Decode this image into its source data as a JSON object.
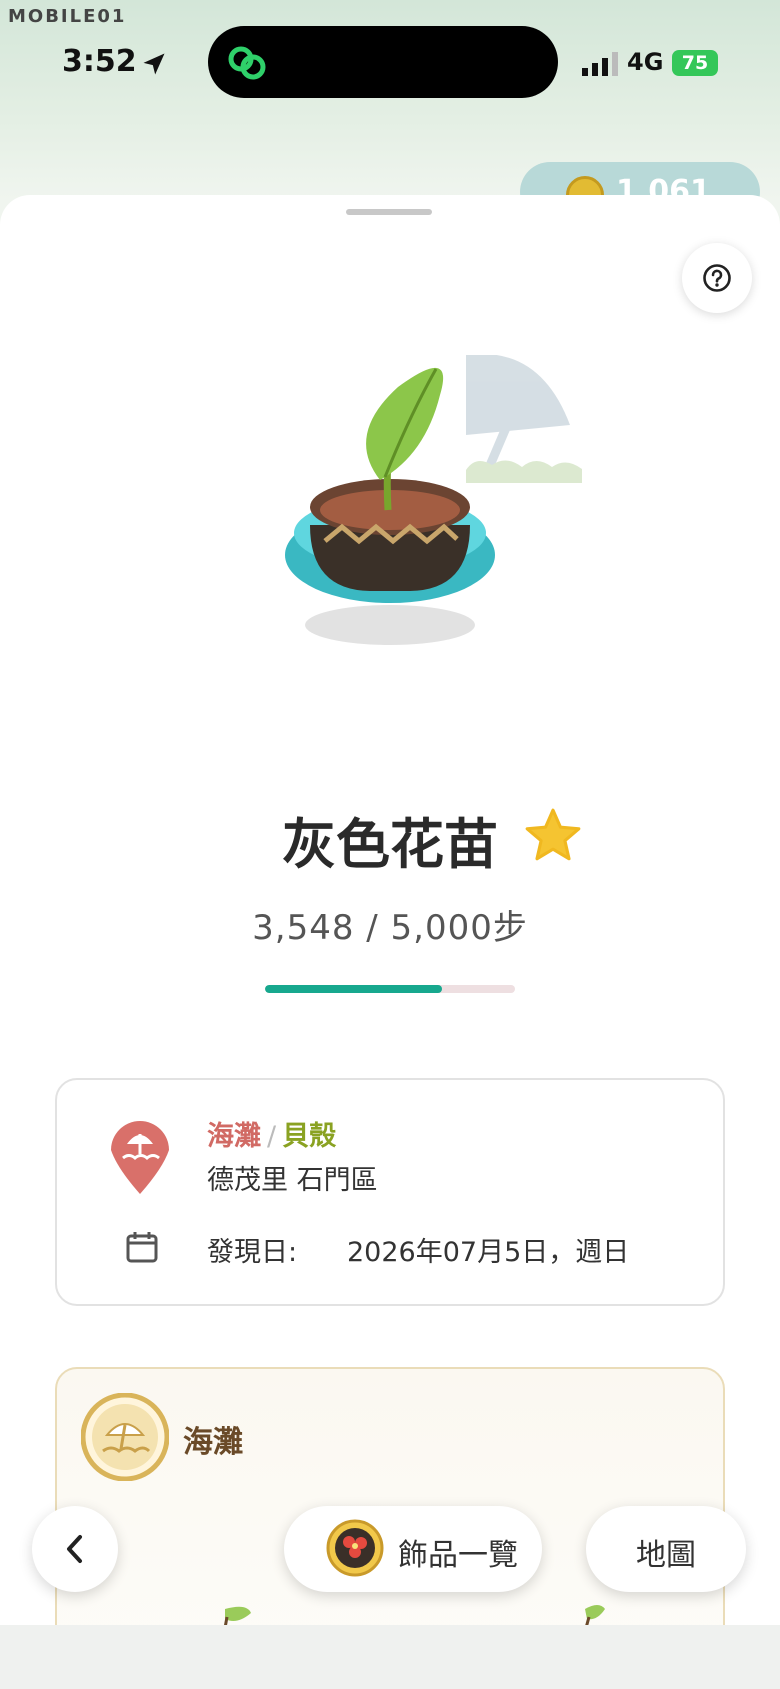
{
  "watermark": "MOBILE01",
  "status": {
    "time": "3:52",
    "network": "4G",
    "battery": "75"
  },
  "coins": {
    "count": "1,061"
  },
  "item": {
    "name": "灰色花苗",
    "steps": "3,548 / 5,000步",
    "progress_fraction": 0.7096,
    "progress_color": "#17a88e"
  },
  "info": {
    "category_primary": "海灘",
    "separator": "/",
    "category_secondary": "貝殼",
    "location": "德茂里 石門區",
    "date_label": "發現日:",
    "date_value": "2026年07月5日，週日"
  },
  "beach_card": {
    "title": "海灘"
  },
  "bottom_bar": {
    "decor_label": "飾品一覽",
    "map_label": "地圖"
  },
  "colors": {
    "accent_red": "#d16a64",
    "accent_green": "#8aa222",
    "star": "#f5c431"
  }
}
